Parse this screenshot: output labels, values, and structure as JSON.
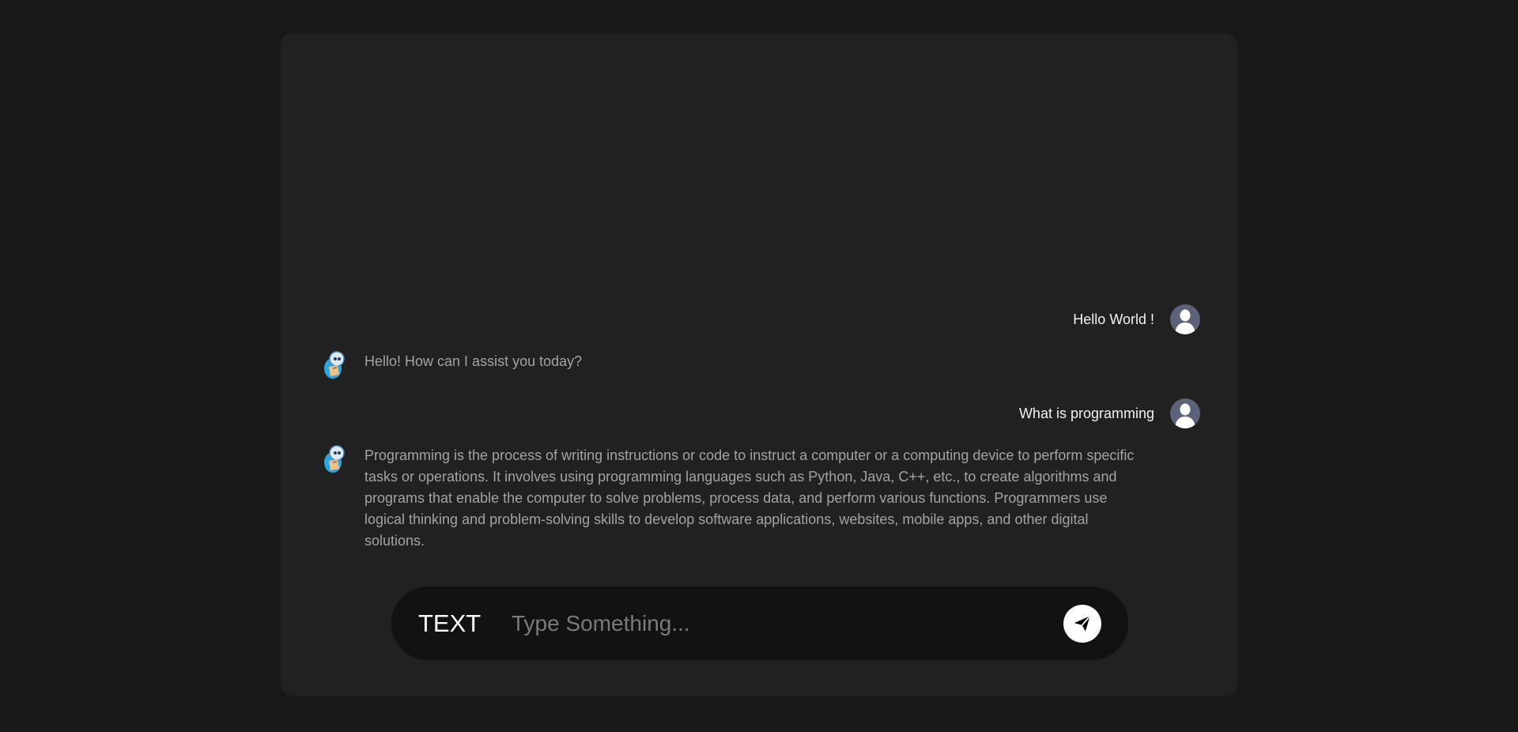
{
  "colors": {
    "page_background": "#181818",
    "panel_background": "#212121",
    "input_background": "#121212",
    "user_text": "#f2f2f2",
    "bot_text": "#a3a3a3",
    "avatar": "#5b6279"
  },
  "messages": [
    {
      "role": "user",
      "text": "Hello World !",
      "icon": "user-avatar-icon"
    },
    {
      "role": "bot",
      "text": "Hello! How can I assist you today?",
      "icon": "bot-avatar-icon"
    },
    {
      "role": "user",
      "text": "What is programming",
      "icon": "user-avatar-icon"
    },
    {
      "role": "bot",
      "text": "Programming is the process of writing instructions or code to instruct a computer or a computing device to perform specific tasks or operations. It involves using programming languages such as Python, Java, C++, etc., to create algorithms and programs that enable the computer to solve problems, process data, and perform various functions. Programmers use logical thinking and problem-solving skills to develop software applications, websites, mobile apps, and other digital solutions.",
      "icon": "bot-avatar-icon"
    }
  ],
  "input": {
    "mode_label": "TEXT",
    "placeholder": "Type Something...",
    "value": "",
    "send_icon": "send-icon"
  }
}
